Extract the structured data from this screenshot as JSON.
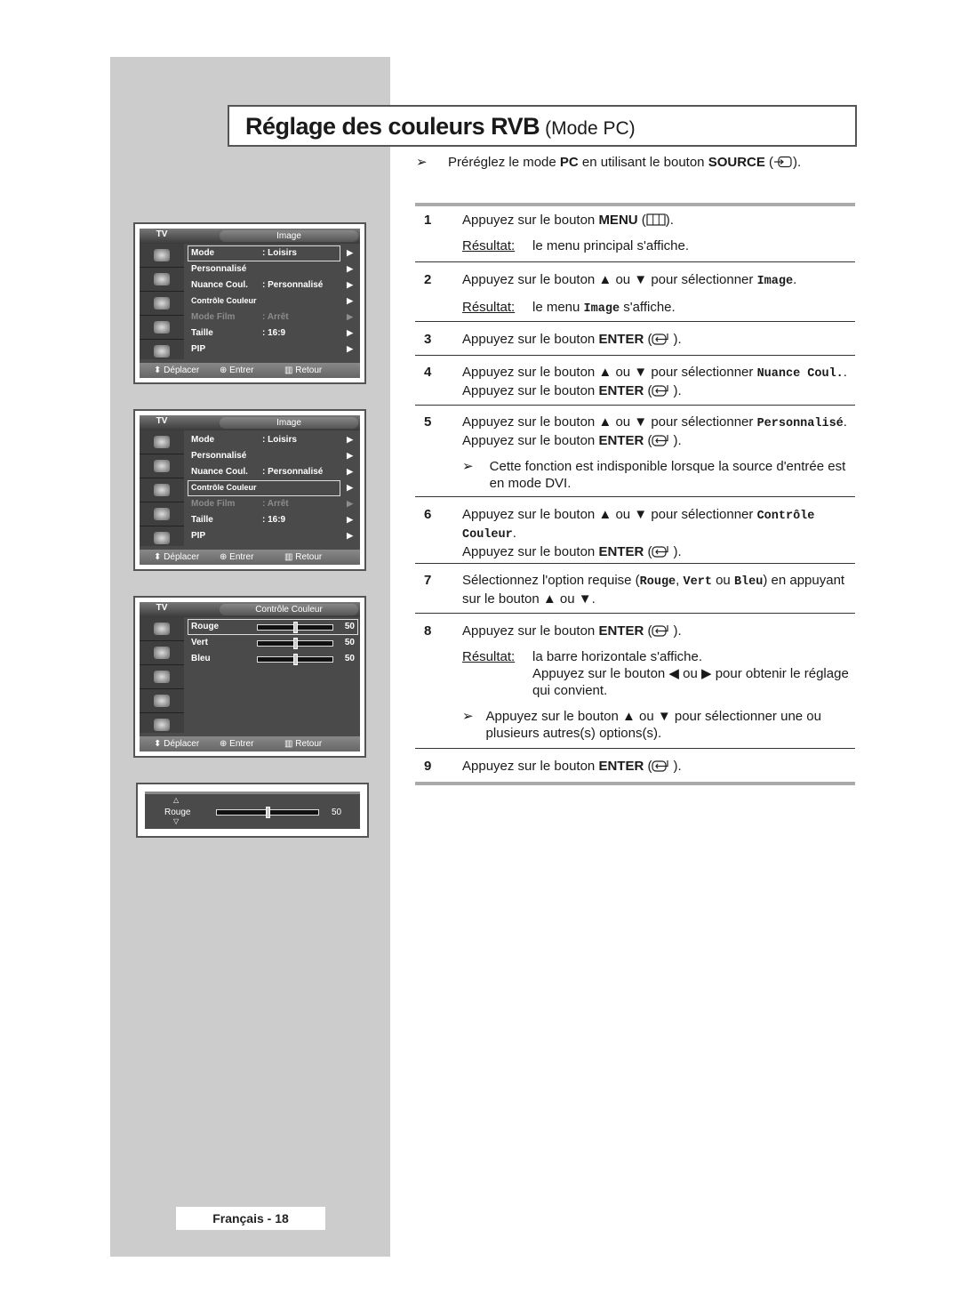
{
  "title": {
    "main": "Réglage des couleurs RVB",
    "sub": "(Mode PC)"
  },
  "preset": {
    "pre": "Préréglez le mode ",
    "kw1": "PC",
    "mid": " en utilisant le bouton ",
    "kw2": "SOURCE",
    "post": ")."
  },
  "common": {
    "press": "Appuyez sur le bouton ",
    "enter": "ENTER",
    "menu": "MENU",
    "up_down_select": "Appuyez sur le bouton ▲ ou ▼ pour sélectionner ",
    "result_label": "Résultat:",
    "open_paren": " (",
    "close": ")."
  },
  "steps": [
    {
      "num": "1",
      "result": "le menu principal s'affiche."
    },
    {
      "num": "2",
      "kw": "Image",
      "result_pre": "le menu ",
      "result_kw": "Image",
      "result_post": " s'affiche."
    },
    {
      "num": "3"
    },
    {
      "num": "4",
      "kw": "Nuance Coul."
    },
    {
      "num": "5",
      "kw": "Personnalisé",
      "note": "Cette fonction est indisponible lorsque la source d'entrée est en mode DVI."
    },
    {
      "num": "6",
      "kw": "Contrôle Couleur"
    },
    {
      "num": "7",
      "pre": "Sélectionnez l'option requise (",
      "opt1": "Rouge",
      "sep1": ", ",
      "opt2": "Vert",
      "sep2": " ou ",
      "opt3": "Bleu",
      "post": ") en appuyant sur le bouton ▲ ou ▼."
    },
    {
      "num": "8",
      "result1": "la barre horizontale s'affiche.",
      "result2": "Appuyez sur le bouton ◀ ou ▶ pour obtenir le réglage qui convient.",
      "note": "Appuyez sur le bouton ▲ ou ▼ pour sélectionner une ou plusieurs autres(s) options(s)."
    },
    {
      "num": "9"
    }
  ],
  "osd": {
    "tv_label": "TV",
    "image_tab": "Image",
    "color_tab": "Contrôle Couleur",
    "icons": [
      "input-icon",
      "picture-icon",
      "sound-icon",
      "channel-icon",
      "setup-icon"
    ],
    "image_menu": [
      {
        "label": "Mode",
        "value": ": Loisirs",
        "dim": false,
        "small": false
      },
      {
        "label": "Personnalisé",
        "value": "",
        "dim": false,
        "small": false
      },
      {
        "label": "Nuance Coul.",
        "value": ": Personnalisé",
        "dim": false,
        "small": false
      },
      {
        "label": "Contrôle Couleur",
        "value": "",
        "dim": false,
        "small": true
      },
      {
        "label": "Mode Film",
        "value": ": Arrêt",
        "dim": true,
        "small": false
      },
      {
        "label": "Taille",
        "value": ": 16:9",
        "dim": false,
        "small": false
      },
      {
        "label": "PIP",
        "value": "",
        "dim": false,
        "small": false
      }
    ],
    "color_menu": [
      {
        "label": "Rouge",
        "value": 50
      },
      {
        "label": "Vert",
        "value": 50
      },
      {
        "label": "Bleu",
        "value": 50
      }
    ],
    "footer": {
      "move": "Déplacer",
      "enter": "Entrer",
      "back": "Retour"
    },
    "bar": {
      "label": "Rouge",
      "value": 50,
      "max": 100
    }
  },
  "page_footer": "Français - 18"
}
